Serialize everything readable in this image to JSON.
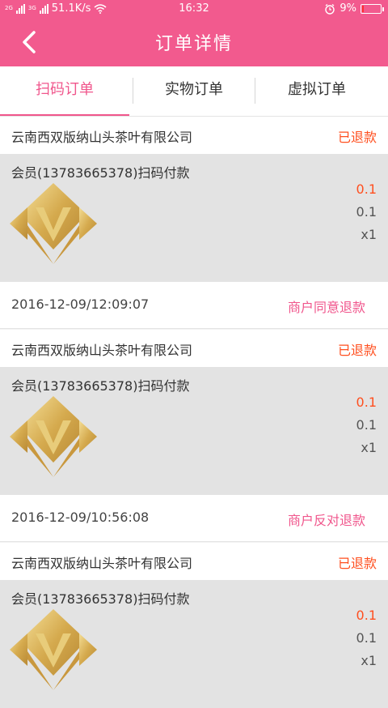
{
  "status_bar": {
    "network_2g": "2G",
    "network_3g": "3G",
    "speed": "51.1K/s",
    "time": "16:32",
    "battery": "9%",
    "battery_level": 0.09
  },
  "header": {
    "title": "订单详情"
  },
  "tabs": [
    {
      "label": "扫码订单",
      "active": true
    },
    {
      "label": "实物订单",
      "active": false
    },
    {
      "label": "虚拟订单",
      "active": false
    }
  ],
  "orders": [
    {
      "shop": "云南西双版纳山头茶叶有限公司",
      "status": "已退款",
      "member": "会员(13783665378)扫码付款",
      "price": "0.1",
      "original_price": "0.1",
      "quantity": "x1",
      "time": "2016-12-09/12:09:07",
      "action": "商户同意退款"
    },
    {
      "shop": "云南西双版纳山头茶叶有限公司",
      "status": "已退款",
      "member": "会员(13783665378)扫码付款",
      "price": "0.1",
      "original_price": "0.1",
      "quantity": "x1",
      "time": "2016-12-09/10:56:08",
      "action": "商户反对退款"
    },
    {
      "shop": "云南西双版纳山头茶叶有限公司",
      "status": "已退款",
      "member": "会员(13783665378)扫码付款",
      "price": "0.1",
      "original_price": "0.1",
      "quantity": "x1",
      "time": "",
      "action": ""
    }
  ],
  "colors": {
    "brand": "#f25a8e",
    "accent_text": "#f0568c",
    "status": "#ff4f1f"
  },
  "icons": {
    "back": "chevron-left-icon",
    "wifi": "wifi-icon",
    "alarm": "alarm-clock-icon",
    "battery": "battery-icon",
    "logo": "gold-v-logo"
  }
}
